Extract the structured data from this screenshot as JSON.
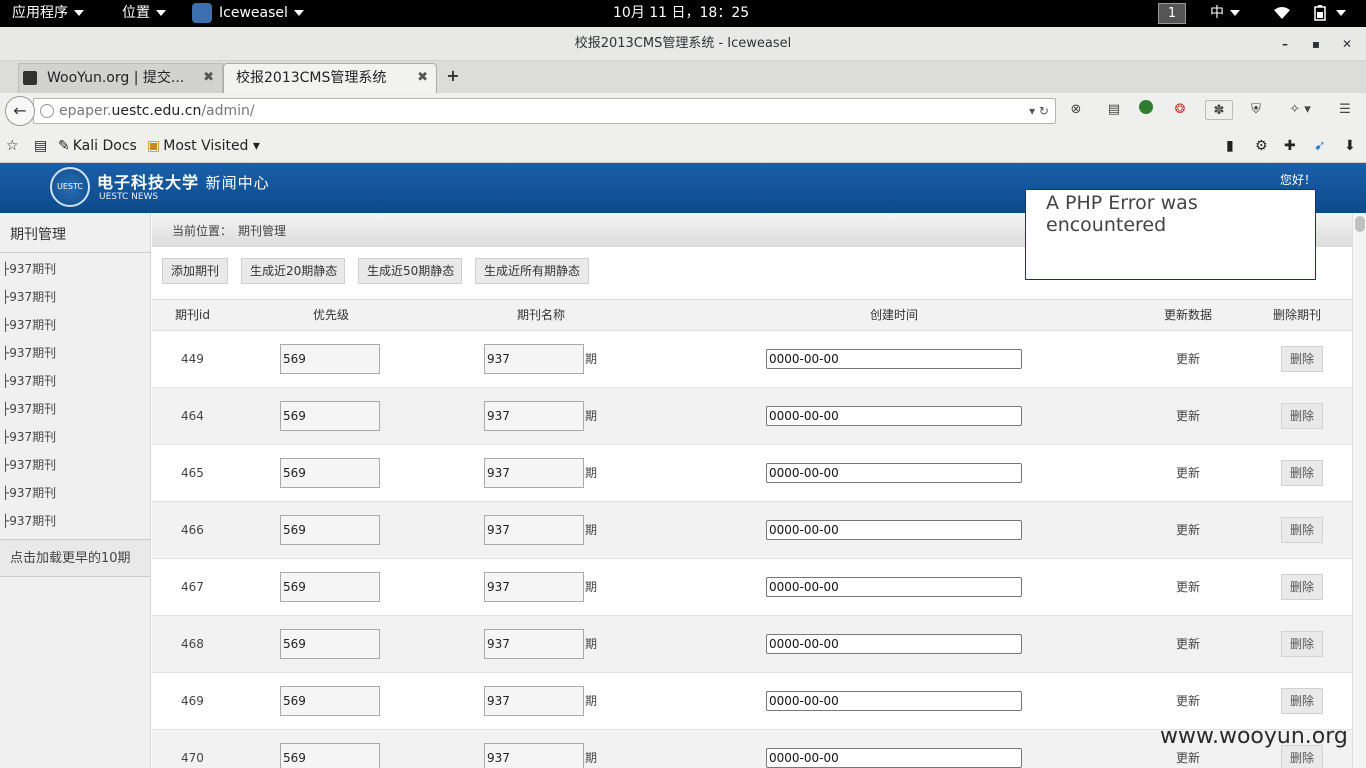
{
  "system_bar": {
    "applications": "应用程序",
    "places": "位置",
    "app_name": "Iceweasel",
    "clock": "10月 11 日，18：25",
    "workspace": "1",
    "input_method": "中"
  },
  "window": {
    "title": "校报2013CMS管理系统 - Iceweasel",
    "minimize": "–",
    "maximize": "▪",
    "close": "✕"
  },
  "tabs": [
    {
      "label": "WooYun.org | 提交...",
      "active": false
    },
    {
      "label": "校报2013CMS管理系统",
      "active": true
    }
  ],
  "new_tab": "+",
  "address": {
    "prefix": "epaper.",
    "host": "uestc.edu.cn",
    "path": "/admin/"
  },
  "bookmarks": {
    "kali_docs": "Kali Docs",
    "most_visited": "Most Visited"
  },
  "site": {
    "logo_text": "电子科技大学",
    "logo_suffix": "新闻中心",
    "logo_sub": "UESTC NEWS",
    "logo_mark": "UESTC",
    "greeting": "您好！"
  },
  "error": {
    "title": "A PHP Error was encountered"
  },
  "sidebar": {
    "title": "期刊管理",
    "items": [
      "937期刊",
      "937期刊",
      "937期刊",
      "937期刊",
      "937期刊",
      "937期刊",
      "937期刊",
      "937期刊",
      "937期刊",
      "937期刊"
    ],
    "load_more": "点击加载更早的10期"
  },
  "breadcrumb": {
    "label": "当前位置：",
    "current": "期刊管理"
  },
  "actions": {
    "add": "添加期刊",
    "gen20": "生成近20期静态",
    "gen50": "生成近50期静态",
    "gen_all": "生成近所有期静态"
  },
  "table": {
    "headers": {
      "id": "期刊id",
      "priority": "优先级",
      "name": "期刊名称",
      "created": "创建时间",
      "update": "更新数据",
      "delete": "删除期刊"
    },
    "unit": "期",
    "update_label": "更新",
    "delete_label": "删除",
    "rows": [
      {
        "id": "449",
        "priority": "569",
        "name": "937",
        "date": "0000-00-00"
      },
      {
        "id": "464",
        "priority": "569",
        "name": "937",
        "date": "0000-00-00"
      },
      {
        "id": "465",
        "priority": "569",
        "name": "937",
        "date": "0000-00-00"
      },
      {
        "id": "466",
        "priority": "569",
        "name": "937",
        "date": "0000-00-00"
      },
      {
        "id": "467",
        "priority": "569",
        "name": "937",
        "date": "0000-00-00"
      },
      {
        "id": "468",
        "priority": "569",
        "name": "937",
        "date": "0000-00-00"
      },
      {
        "id": "469",
        "priority": "569",
        "name": "937",
        "date": "0000-00-00"
      },
      {
        "id": "470",
        "priority": "569",
        "name": "937",
        "date": "0000-00-00"
      }
    ]
  },
  "watermark": "www.wooyun.org"
}
